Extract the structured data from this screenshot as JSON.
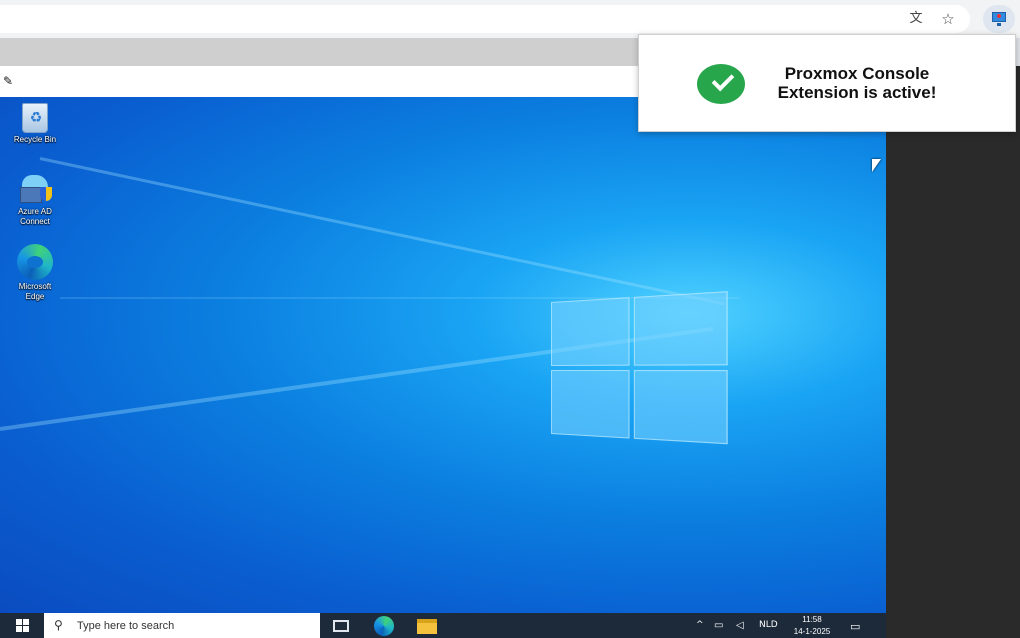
{
  "browser": {
    "translate_icon": "translate-icon",
    "bookmark_icon": "star-icon",
    "extension_icon": "monitor-icon"
  },
  "vm_toolbar": {
    "edit_icon": "pencil-icon"
  },
  "desktop": {
    "icons": [
      {
        "label": "Recycle Bin",
        "icon": "recycle-bin-icon"
      },
      {
        "label": "Azure AD Connect",
        "icon": "azure-ad-connect-icon"
      },
      {
        "label": "Microsoft Edge",
        "icon": "edge-icon"
      }
    ]
  },
  "taskbar": {
    "search_placeholder": "Type here to search",
    "language": "NLD",
    "time": "11:58",
    "date": "14-1-2025"
  },
  "notification": {
    "line1": "Proxmox Console",
    "line2": "Extension is active!",
    "accent": "#27a64b"
  }
}
